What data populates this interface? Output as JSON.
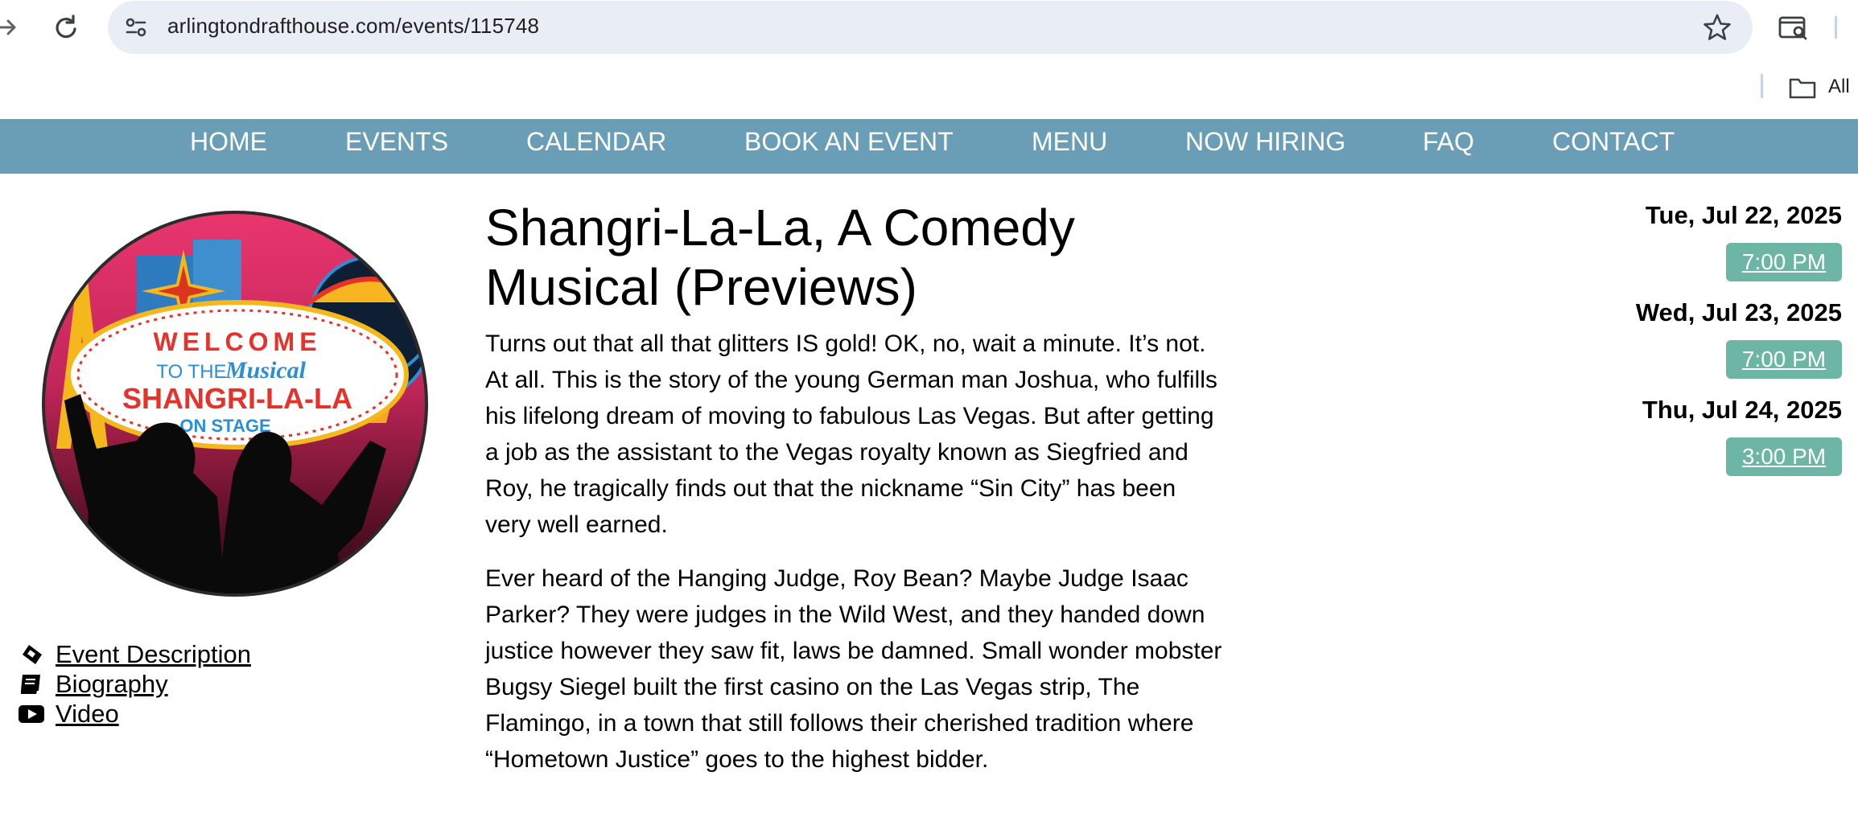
{
  "browser": {
    "url": "arlingtondrafthouse.com/events/115748",
    "bookmarks_label": "All"
  },
  "nav": {
    "items": [
      {
        "label": "HOME"
      },
      {
        "label": "EVENTS"
      },
      {
        "label": "CALENDAR"
      },
      {
        "label": "BOOK AN EVENT"
      },
      {
        "label": "MENU"
      },
      {
        "label": "NOW HIRING"
      },
      {
        "label": "FAQ"
      },
      {
        "label": "CONTACT"
      }
    ],
    "color": "#6a9eb7"
  },
  "poster": {
    "line1": "WELCOME",
    "line2": "TO THE",
    "line2b": "Musical",
    "line3": "SHANGRI-LA-LA",
    "line4": "ON STAGE"
  },
  "side_links": [
    {
      "label": "Event Description",
      "icon": "ticket-icon"
    },
    {
      "label": "Biography",
      "icon": "book-icon"
    },
    {
      "label": "Video",
      "icon": "youtube-icon"
    }
  ],
  "event": {
    "title": "Shangri-La-La, A Comedy Musical (Previews)",
    "paragraphs": [
      "Turns out that all that glitters IS gold! OK, no, wait a minute. It’s not. At all. This is the story of the young German man Joshua, who fulfills his lifelong dream of moving to fabulous Las Vegas. But after getting a job as the assistant to the Vegas royalty known as Siegfried and Roy, he tragically finds out that the nickname “Sin City” has been very well earned.",
      "Ever heard of the Hanging Judge, Roy Bean? Maybe Judge Isaac Parker? They were judges in the Wild West, and they handed down justice however they saw fit, laws be damned. Small wonder mobster Bugsy Siegel built the first casino on the Las Vegas strip, The Flamingo, in a town that still follows their cherished tradition where “Hometown Justice” goes to the highest bidder."
    ]
  },
  "showtimes": [
    {
      "date": "Tue, Jul 22, 2025",
      "time": "7:00 PM"
    },
    {
      "date": "Wed, Jul 23, 2025",
      "time": "7:00 PM"
    },
    {
      "date": "Thu, Jul 24, 2025",
      "time": "3:00 PM"
    }
  ],
  "colors": {
    "showtime_button": "#6db5a4",
    "omnibox": "#e9eef6"
  }
}
